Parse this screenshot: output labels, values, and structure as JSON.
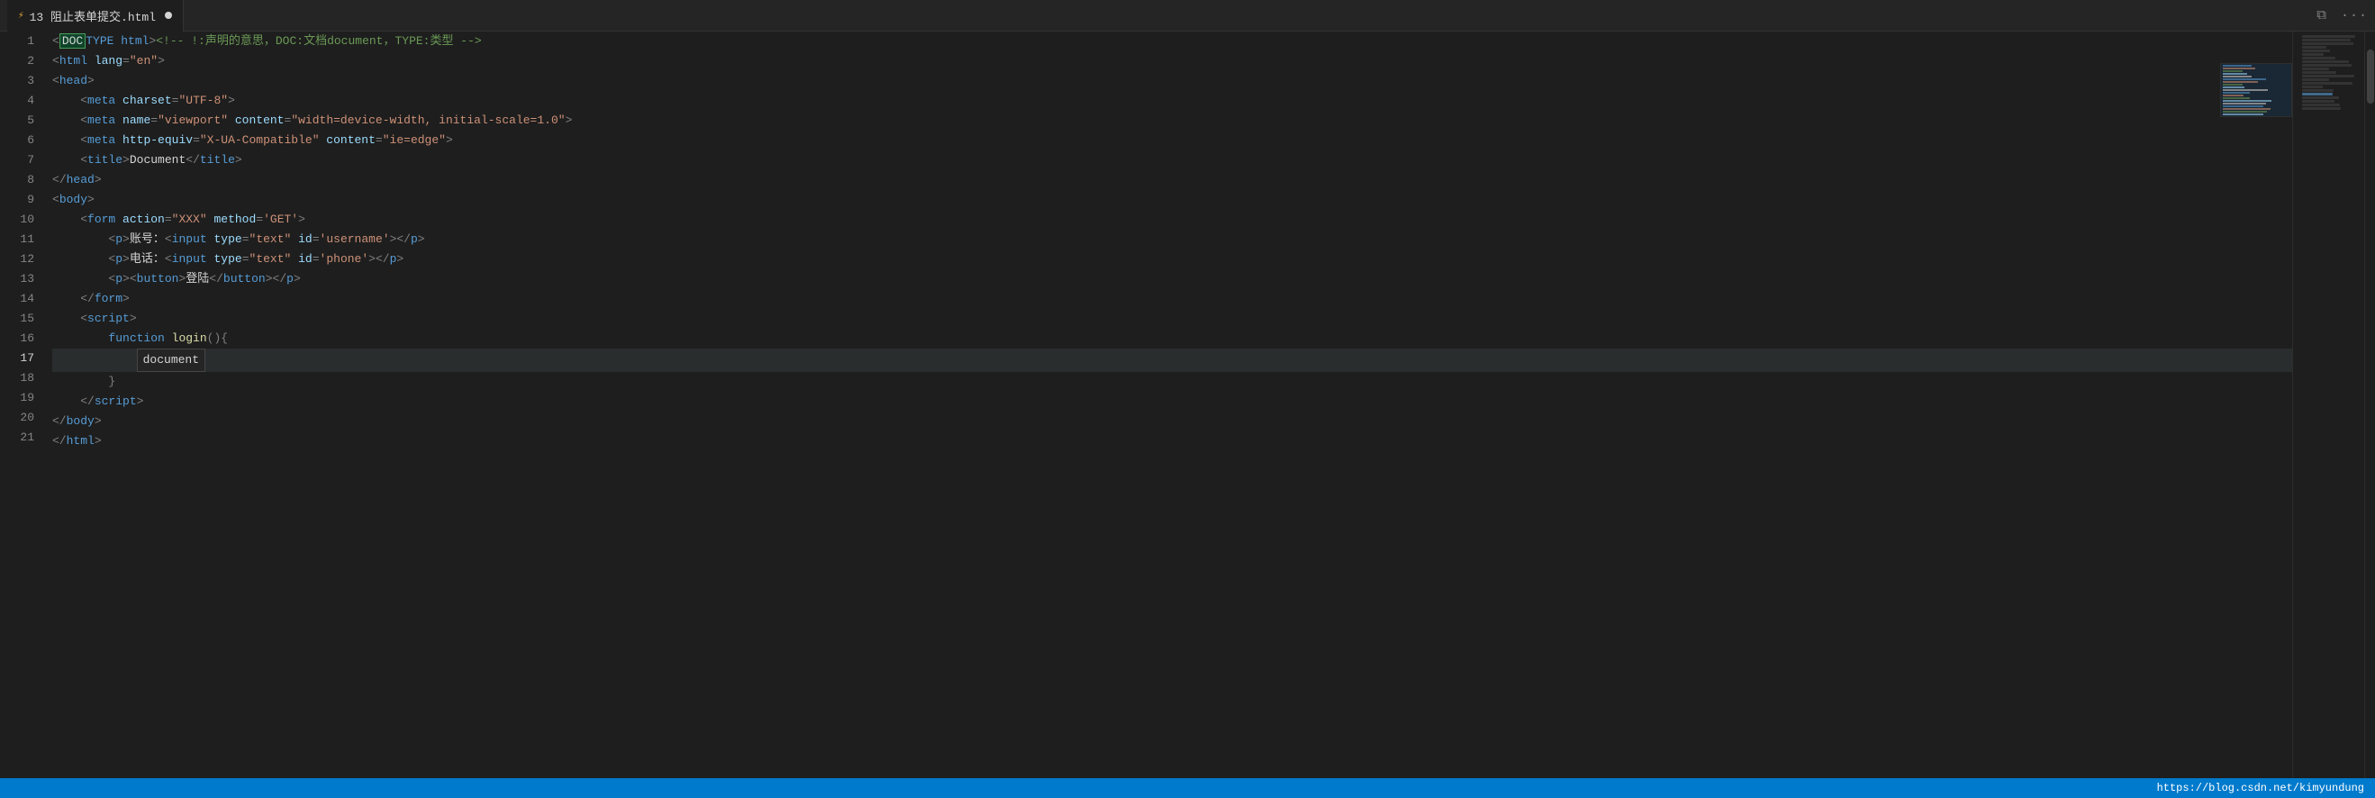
{
  "tab": {
    "icon": "⚡",
    "label": "13 阻止表单提交.html",
    "modified": true
  },
  "toolbar_right": {
    "split_icon": "⧉",
    "more_icon": "···"
  },
  "lines": [
    {
      "num": 1,
      "tokens": [
        {
          "type": "punct",
          "text": "<"
        },
        {
          "type": "highlight",
          "text": "DOC"
        },
        {
          "type": "tag",
          "text": "TYPE html"
        },
        {
          "type": "punct",
          "text": ">"
        },
        {
          "type": "comment",
          "text": "<!-- !:声明的意思，DOC:文档document，TYPE:类型 -->"
        }
      ]
    },
    {
      "num": 2,
      "tokens": [
        {
          "type": "punct",
          "text": "<"
        },
        {
          "type": "tag",
          "text": "html"
        },
        {
          "type": "attr",
          "text": " lang"
        },
        {
          "type": "punct",
          "text": "="
        },
        {
          "type": "str",
          "text": "\"en\""
        },
        {
          "type": "punct",
          "text": ">"
        }
      ]
    },
    {
      "num": 3,
      "tokens": [
        {
          "type": "punct",
          "text": "<"
        },
        {
          "type": "tag",
          "text": "head"
        },
        {
          "type": "punct",
          "text": ">"
        }
      ]
    },
    {
      "num": 4,
      "tokens": [
        {
          "type": "punct",
          "text": "    <"
        },
        {
          "type": "tag",
          "text": "meta"
        },
        {
          "type": "attr",
          "text": " charset"
        },
        {
          "type": "punct",
          "text": "="
        },
        {
          "type": "str",
          "text": "\"UTF-8\""
        },
        {
          "type": "punct",
          "text": ">"
        }
      ]
    },
    {
      "num": 5,
      "tokens": [
        {
          "type": "punct",
          "text": "    <"
        },
        {
          "type": "tag",
          "text": "meta"
        },
        {
          "type": "attr",
          "text": " name"
        },
        {
          "type": "punct",
          "text": "="
        },
        {
          "type": "str",
          "text": "\"viewport\""
        },
        {
          "type": "attr",
          "text": " content"
        },
        {
          "type": "punct",
          "text": "="
        },
        {
          "type": "str",
          "text": "\"width=device-width, initial-scale=1.0\""
        },
        {
          "type": "punct",
          "text": ">"
        }
      ]
    },
    {
      "num": 6,
      "tokens": [
        {
          "type": "punct",
          "text": "    <"
        },
        {
          "type": "tag",
          "text": "meta"
        },
        {
          "type": "attr",
          "text": " http-equiv"
        },
        {
          "type": "punct",
          "text": "="
        },
        {
          "type": "str",
          "text": "\"X-UA-Compatible\""
        },
        {
          "type": "attr",
          "text": " content"
        },
        {
          "type": "punct",
          "text": "="
        },
        {
          "type": "str",
          "text": "\"ie=edge\""
        },
        {
          "type": "punct",
          "text": ">"
        }
      ]
    },
    {
      "num": 7,
      "tokens": [
        {
          "type": "punct",
          "text": "    <"
        },
        {
          "type": "tag",
          "text": "title"
        },
        {
          "type": "punct",
          "text": ">"
        },
        {
          "type": "text",
          "text": "Document"
        },
        {
          "type": "punct",
          "text": "</"
        },
        {
          "type": "tag",
          "text": "title"
        },
        {
          "type": "punct",
          "text": ">"
        }
      ]
    },
    {
      "num": 8,
      "tokens": [
        {
          "type": "punct",
          "text": "<"
        },
        {
          "type": "punct2",
          "text": "/"
        },
        {
          "type": "tag",
          "text": "head"
        },
        {
          "type": "punct",
          "text": ">"
        }
      ]
    },
    {
      "num": 9,
      "tokens": [
        {
          "type": "punct",
          "text": "<"
        },
        {
          "type": "tag",
          "text": "body"
        },
        {
          "type": "punct",
          "text": ">"
        }
      ]
    },
    {
      "num": 10,
      "tokens": [
        {
          "type": "punct",
          "text": "    <"
        },
        {
          "type": "tag",
          "text": "form"
        },
        {
          "type": "attr",
          "text": " action"
        },
        {
          "type": "punct",
          "text": "="
        },
        {
          "type": "str",
          "text": "\"XXX\""
        },
        {
          "type": "attr",
          "text": " method"
        },
        {
          "type": "punct",
          "text": "="
        },
        {
          "type": "str-single",
          "text": "'GET'"
        },
        {
          "type": "punct",
          "text": ">"
        }
      ]
    },
    {
      "num": 11,
      "tokens": [
        {
          "type": "punct",
          "text": "        <"
        },
        {
          "type": "tag",
          "text": "p"
        },
        {
          "type": "punct",
          "text": ">"
        },
        {
          "type": "text",
          "text": "账号："
        },
        {
          "type": "punct",
          "text": "<"
        },
        {
          "type": "tag",
          "text": "input"
        },
        {
          "type": "attr",
          "text": " type"
        },
        {
          "type": "punct",
          "text": "="
        },
        {
          "type": "str",
          "text": "\"text\""
        },
        {
          "type": "attr",
          "text": " id"
        },
        {
          "type": "punct",
          "text": "="
        },
        {
          "type": "str-single",
          "text": "'username'"
        },
        {
          "type": "punct",
          "text": "></"
        },
        {
          "type": "tag",
          "text": "p"
        },
        {
          "type": "punct",
          "text": ">"
        }
      ]
    },
    {
      "num": 12,
      "tokens": [
        {
          "type": "punct",
          "text": "        <"
        },
        {
          "type": "tag",
          "text": "p"
        },
        {
          "type": "punct",
          "text": ">"
        },
        {
          "type": "text",
          "text": "电话："
        },
        {
          "type": "punct",
          "text": "<"
        },
        {
          "type": "tag",
          "text": "input"
        },
        {
          "type": "attr",
          "text": " type"
        },
        {
          "type": "punct",
          "text": "="
        },
        {
          "type": "str",
          "text": "\"text\""
        },
        {
          "type": "attr",
          "text": " id"
        },
        {
          "type": "punct",
          "text": "="
        },
        {
          "type": "str-single",
          "text": "'phone'"
        },
        {
          "type": "punct",
          "text": "></"
        },
        {
          "type": "tag",
          "text": "p"
        },
        {
          "type": "punct",
          "text": ">"
        }
      ]
    },
    {
      "num": 13,
      "tokens": [
        {
          "type": "punct",
          "text": "        <"
        },
        {
          "type": "tag",
          "text": "p"
        },
        {
          "type": "punct",
          "text": ">"
        },
        {
          "type": "punct",
          "text": "<"
        },
        {
          "type": "tag",
          "text": "button"
        },
        {
          "type": "punct",
          "text": ">"
        },
        {
          "type": "text",
          "text": "登陆"
        },
        {
          "type": "punct",
          "text": "</"
        },
        {
          "type": "tag",
          "text": "button"
        },
        {
          "type": "punct",
          "text": "></"
        },
        {
          "type": "tag",
          "text": "p"
        },
        {
          "type": "punct",
          "text": ">"
        }
      ]
    },
    {
      "num": 14,
      "tokens": [
        {
          "type": "punct",
          "text": "    </"
        },
        {
          "type": "tag",
          "text": "form"
        },
        {
          "type": "punct",
          "text": ">"
        }
      ]
    },
    {
      "num": 15,
      "tokens": [
        {
          "type": "punct",
          "text": "    <"
        },
        {
          "type": "tag",
          "text": "script"
        },
        {
          "type": "punct",
          "text": ">"
        }
      ]
    },
    {
      "num": 16,
      "tokens": [
        {
          "type": "punct",
          "text": "        "
        },
        {
          "type": "kw",
          "text": "function"
        },
        {
          "type": "text",
          "text": " "
        },
        {
          "type": "fn",
          "text": "login"
        },
        {
          "type": "punct",
          "text": "(){"
        }
      ]
    },
    {
      "num": 17,
      "active": true,
      "tokens": [
        {
          "type": "punct",
          "text": "            "
        },
        {
          "type": "autocomplete",
          "text": "document"
        }
      ]
    },
    {
      "num": 18,
      "tokens": [
        {
          "type": "punct",
          "text": "        }"
        }
      ]
    },
    {
      "num": 19,
      "tokens": [
        {
          "type": "punct",
          "text": "    </"
        },
        {
          "type": "tag",
          "text": "script"
        },
        {
          "type": "punct",
          "text": ">"
        }
      ]
    },
    {
      "num": 20,
      "tokens": [
        {
          "type": "punct",
          "text": "</"
        },
        {
          "type": "tag",
          "text": "body"
        },
        {
          "type": "punct",
          "text": ">"
        }
      ]
    },
    {
      "num": 21,
      "tokens": [
        {
          "type": "punct",
          "text": "</"
        },
        {
          "type": "tag",
          "text": "html"
        },
        {
          "type": "punct",
          "text": ">"
        }
      ]
    }
  ],
  "status_bar": {
    "link": "https://blog.csdn.net/kimyundung"
  },
  "minimap_colors": {
    "comment": "#6a9955",
    "tag": "#569cd6",
    "str": "#ce9178",
    "text": "#d4d4d4",
    "bg": "#1e1e1e"
  }
}
